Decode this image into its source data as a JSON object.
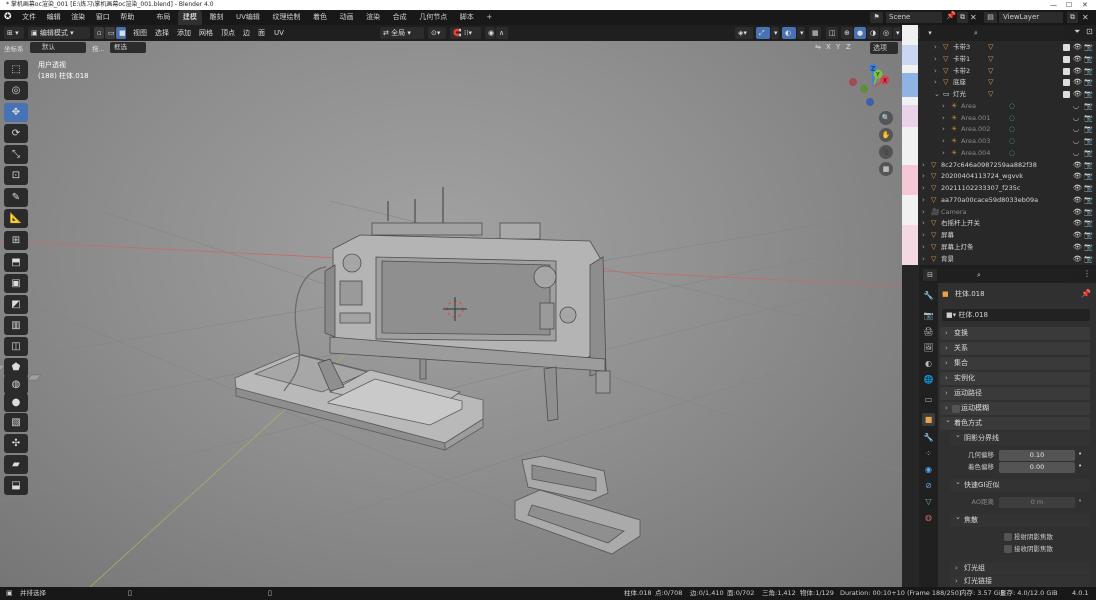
{
  "window": {
    "title": "* 掌机画幕oc渲染_001 [E:\\练习\\掌机画幕oc渲染_001.blend] - Blender 4.0"
  },
  "menubar": {
    "menus": [
      "文件",
      "编辑",
      "渲染",
      "窗口",
      "帮助"
    ],
    "workspaces": [
      "布局",
      "建模",
      "雕刻",
      "UV编辑",
      "纹理绘制",
      "着色",
      "动画",
      "渲染",
      "合成",
      "几何节点",
      "脚本"
    ],
    "active_workspace": "建模",
    "add_tab": "+",
    "scene": "Scene",
    "view_layer": "ViewLayer"
  },
  "viewport_header": {
    "mode": "编辑模式",
    "menus": [
      "视图",
      "选择",
      "添加",
      "网格",
      "顶点",
      "边",
      "面",
      "UV"
    ],
    "transform_orientation": "全局",
    "axes": [
      "X",
      "Y",
      "Z"
    ],
    "options": "选项",
    "coord_label": "坐标系",
    "coord_value": "默认",
    "drag_label": "拖...",
    "drag_value": "框选"
  },
  "viewport": {
    "view_name": "用户透视",
    "object_info": "(188) 柱体.018"
  },
  "gizmo": {
    "x": "X",
    "y": "Y",
    "z": "Z"
  },
  "outliner": {
    "search_placeholder": "",
    "items": [
      {
        "label": "卡带3",
        "type": "mesh",
        "indent": 1
      },
      {
        "label": "卡带1",
        "type": "mesh",
        "indent": 1
      },
      {
        "label": "卡带2",
        "type": "mesh",
        "indent": 1
      },
      {
        "label": "底座",
        "type": "mesh",
        "indent": 1
      },
      {
        "label": "灯光",
        "type": "collection",
        "indent": 1
      },
      {
        "label": "Area",
        "type": "light",
        "indent": 2
      },
      {
        "label": "Area.001",
        "type": "light",
        "indent": 2
      },
      {
        "label": "Area.002",
        "type": "light",
        "indent": 2
      },
      {
        "label": "Area.003",
        "type": "light",
        "indent": 2
      },
      {
        "label": "Area.004",
        "type": "light",
        "indent": 2
      },
      {
        "label": "8c27c646a0987259aa882f38",
        "type": "mesh",
        "indent": 0
      },
      {
        "label": "20200404113724_wgvvk",
        "type": "mesh",
        "indent": 0
      },
      {
        "label": "20211102233307_f235c",
        "type": "mesh",
        "indent": 0
      },
      {
        "label": "aa770a00cace59d8033eb09a",
        "type": "mesh",
        "indent": 0
      },
      {
        "label": "Camera",
        "type": "camera",
        "indent": 0
      },
      {
        "label": "右摇杆上开关",
        "type": "mesh",
        "indent": 0
      },
      {
        "label": "屏幕",
        "type": "mesh",
        "indent": 0
      },
      {
        "label": "屏幕上灯条",
        "type": "mesh",
        "indent": 0
      },
      {
        "label": "背景",
        "type": "mesh",
        "indent": 0
      }
    ]
  },
  "properties": {
    "object_name": "柱体.018",
    "data_name": "柱体.018",
    "sections": [
      "变换",
      "关系",
      "集合",
      "实例化",
      "运动路径",
      "运动模糊",
      "着色方式"
    ],
    "shadow_terminator": "阴影分界线",
    "geometry_offset_label": "几何偏移",
    "geometry_offset": "0.10",
    "shading_offset_label": "着色偏移",
    "shading_offset": "0.00",
    "fast_gi": "快速GI近似",
    "ao_distance_label": "AO距离",
    "ao_distance": "0 m",
    "caustics": "焦散",
    "cast_caustics": "投射阴影焦散",
    "receive_caustics": "接收阴影焦散",
    "light_group": "灯光组",
    "light_linking": "灯光链接"
  },
  "status": {
    "left": "并排选择",
    "object": "柱体.018",
    "verts": "点:0/708",
    "edges": "边:0/1,410",
    "faces": "面:0/702",
    "tris": "三角:1,412",
    "objects": "物体:1/129",
    "duration": "Duration: 00:10+10 (Frame 188/250)",
    "memory": "内存: 3.57 GiB",
    "vram": "显存: 4.0/12.0 GiB",
    "version": "4.0.1"
  },
  "colors": {
    "accent": "#4772b3",
    "mesh_icon": "#e6a24e",
    "light_icon": "#c58a3a",
    "modifier_icon": "#5ec78a",
    "x_axis": "#d9414f",
    "y_axis": "#7ec144",
    "z_axis": "#3d7fe0"
  }
}
